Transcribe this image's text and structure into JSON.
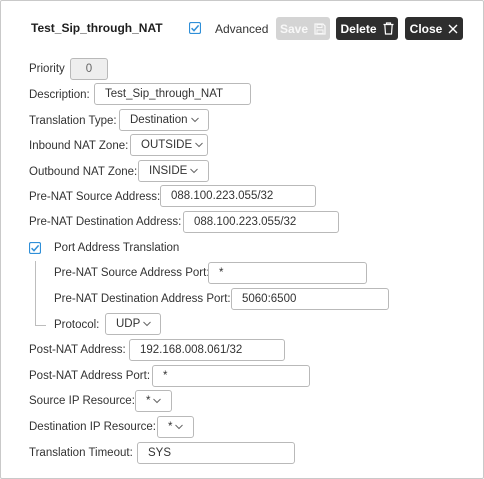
{
  "header": {
    "title": "Test_Sip_through_NAT",
    "advanced_label": "Advanced",
    "save_label": "Save",
    "delete_label": "Delete",
    "close_label": "Close"
  },
  "form": {
    "priority": {
      "label": "Priority",
      "value": "0"
    },
    "description": {
      "label": "Description:",
      "value": "Test_Sip_through_NAT"
    },
    "translation_type": {
      "label": "Translation Type:",
      "value": "Destination"
    },
    "inbound_zone": {
      "label": "Inbound NAT Zone:",
      "value": "OUTSIDE"
    },
    "outbound_zone": {
      "label": "Outbound NAT Zone:",
      "value": "INSIDE"
    },
    "pre_src_addr": {
      "label": "Pre-NAT Source Address:",
      "value": "088.100.223.055/32"
    },
    "pre_dst_addr": {
      "label": "Pre-NAT Destination Address:",
      "value": "088.100.223.055/32"
    },
    "pat": {
      "label": "Port Address Translation",
      "checked": true
    },
    "pre_src_port": {
      "label": "Pre-NAT Source Address Port:",
      "value": "*"
    },
    "pre_dst_port": {
      "label": "Pre-NAT Destination Address Port:",
      "value": "5060:6500"
    },
    "protocol": {
      "label": "Protocol:",
      "value": "UDP"
    },
    "post_addr": {
      "label": "Post-NAT Address:",
      "value": "192.168.008.061/32"
    },
    "post_port": {
      "label": "Post-NAT Address Port:",
      "value": "*"
    },
    "src_ip_res": {
      "label": "Source IP Resource:",
      "value": "*"
    },
    "dst_ip_res": {
      "label": "Destination IP Resource:",
      "value": "*"
    },
    "timeout": {
      "label": "Translation Timeout:",
      "value": "SYS"
    }
  },
  "colors": {
    "accent": "#2f8fd8",
    "dark_button": "#2e2e2e",
    "disabled_button": "#d4d4d4"
  },
  "icons": {
    "advanced_check": "checkbox-checked-icon",
    "save": "floppy-disk-icon",
    "delete": "trash-icon",
    "close": "close-icon",
    "dropdown": "chevron-down-icon"
  }
}
